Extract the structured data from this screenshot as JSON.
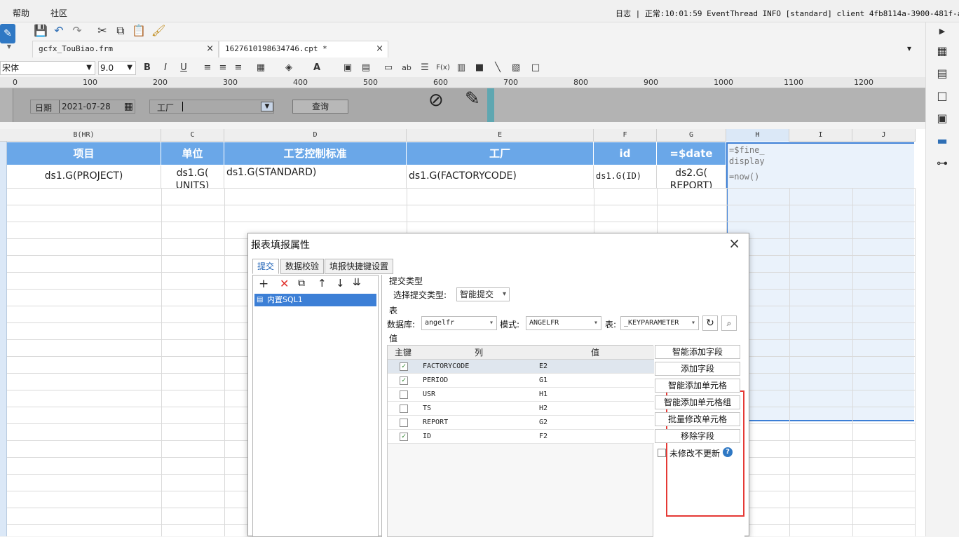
{
  "menu": {
    "help": "帮助",
    "community": "社区"
  },
  "log_line": "日志 | 正常:10:01:59 EventThread INFO [standard] client 4fb8114a-3900-481f-abbd-4",
  "tabs": [
    {
      "label": "gcfx_TouBiao.frm"
    },
    {
      "label": "1627610198634746.cpt *"
    }
  ],
  "format_bar": {
    "font": "宋体",
    "size": "9.0",
    "bold": "B",
    "italic": "I",
    "underline": "U",
    "ab": "ab",
    "fx": "F(x)"
  },
  "ruler_ticks": [
    "0",
    "100",
    "200",
    "300",
    "400",
    "500",
    "600",
    "700",
    "800",
    "900",
    "1000",
    "1100",
    "1200"
  ],
  "form": {
    "date_label": "日期",
    "date_value": "2021-07-28",
    "factory_label": "工厂",
    "query_button": "查询"
  },
  "sheet": {
    "col_headers": [
      "B(HR)",
      "C",
      "D",
      "E",
      "F",
      "G",
      "H",
      "I",
      "J"
    ],
    "header_row": [
      "项目",
      "单位",
      "工艺控制标准",
      "工厂",
      "id",
      "=$date"
    ],
    "data_row": [
      "ds1.G(PROJECT)",
      "ds1.G(\nUNITS)",
      "ds1.G(STANDARD)",
      "ds1.G(FACTORYCODE)",
      "ds1.G(ID)",
      "ds2.G(\nREPORT)"
    ],
    "h_cell_1": "=$fine_\ndisplay",
    "h_cell_2": "=now()"
  },
  "dialog": {
    "title": "报表填报属性",
    "tabs": [
      "提交",
      "数据校验",
      "填报快捷键设置"
    ],
    "tree_item": "内置SQL1",
    "submit_type_section": "提交类型",
    "submit_type_label": "选择提交类型:",
    "submit_type_value": "智能提交",
    "table_section": "表",
    "db_label": "数据库:",
    "db_value": "angelfr",
    "mode_label": "模式:",
    "mode_value": "ANGELFR",
    "table_label": "表:",
    "table_value": "_KEYPARAMETER",
    "value_section": "值",
    "col_key": "主键",
    "col_col": "列",
    "col_val": "值",
    "rows": [
      {
        "checked": true,
        "col": "FACTORYCODE",
        "val": "E2"
      },
      {
        "checked": true,
        "col": "PERIOD",
        "val": "G1"
      },
      {
        "checked": false,
        "col": "USR",
        "val": "H1"
      },
      {
        "checked": false,
        "col": "TS",
        "val": "H2"
      },
      {
        "checked": false,
        "col": "REPORT",
        "val": "G2"
      },
      {
        "checked": true,
        "col": "ID",
        "val": "F2"
      }
    ],
    "buttons": [
      "智能添加字段",
      "添加字段",
      "智能添加单元格",
      "智能添加单元格组",
      "批量修改单元格",
      "移除字段"
    ],
    "no_update_label": "未修改不更新",
    "highlight_color": "#e53935"
  },
  "colors": {
    "header_blue": "#6aa7e8",
    "selection": "#3c7fd6"
  }
}
